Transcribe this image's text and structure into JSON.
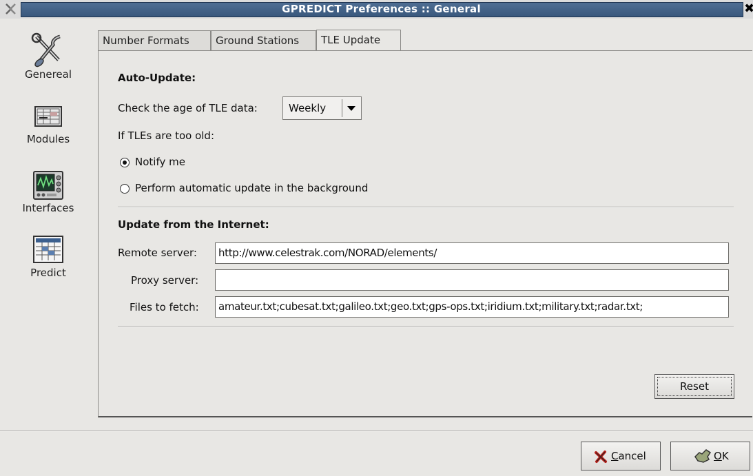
{
  "window": {
    "title": "GPREDICT Preferences :: General",
    "close_glyph": "✖"
  },
  "sidebar": {
    "items": [
      {
        "label": "Genereal",
        "icon": "tools-icon"
      },
      {
        "label": "Modules",
        "icon": "modules-icon"
      },
      {
        "label": "Interfaces",
        "icon": "interfaces-icon"
      },
      {
        "label": "Predict",
        "icon": "predict-icon"
      }
    ]
  },
  "tabs": [
    {
      "label": "Number Formats",
      "active": false
    },
    {
      "label": "Ground Stations",
      "active": false
    },
    {
      "label": "TLE Update",
      "active": true
    }
  ],
  "auto_update": {
    "heading": "Auto-Update:",
    "check_label": "Check the age of TLE data:",
    "check_value": "Weekly",
    "too_old_label": "If TLEs are too old:",
    "options": [
      {
        "label": "Notify me",
        "selected": true
      },
      {
        "label": "Perform automatic update in the background",
        "selected": false
      }
    ]
  },
  "internet": {
    "heading": "Update from the Internet:",
    "remote_label": "Remote server:",
    "remote_value": "http://www.celestrak.com/NORAD/elements/",
    "proxy_label": "Proxy server:",
    "proxy_value": "",
    "files_label": "Files to fetch:",
    "files_value": "amateur.txt;cubesat.txt;galileo.txt;geo.txt;gps-ops.txt;iridium.txt;military.txt;radar.txt;"
  },
  "buttons": {
    "reset": "Reset",
    "cancel_first": "C",
    "cancel_rest": "ancel",
    "ok_first": "O",
    "ok_rest": "K"
  }
}
